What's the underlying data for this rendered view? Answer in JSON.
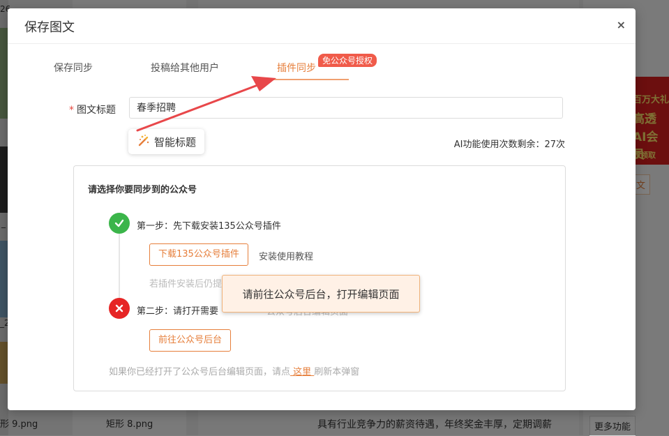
{
  "background": {
    "left_partial_1": "26",
    "left_partial_2": "_",
    "left_partial_3": "_2",
    "file_1": "形 9.png",
    "file_2": "矩形 8.png",
    "right_banner_lines": [
      "百万大礼",
      "高透",
      "AI会员",
      "即领取"
    ],
    "right_link": "文",
    "bottom_text": "具有行业竞争力的薪资待遇，年终奖金丰厚，定期调薪",
    "more_button": "更多功能"
  },
  "modal": {
    "title": "保存图文",
    "close": "×",
    "tabs": [
      {
        "label": "保存同步"
      },
      {
        "label": "投稿给其他用户"
      },
      {
        "label": "插件同步"
      }
    ],
    "tab_badge": "免公众号授权",
    "title_field": {
      "required_mark": "*",
      "label": "图文标题",
      "value": "春季招聘"
    },
    "smart_title_button": "智能标题",
    "ai_remaining": "AI功能使用次数剩余：27次",
    "sync_panel": {
      "heading": "请选择你要同步到的公众号",
      "step1_text": "第一步：先下载安装135公众号插件",
      "download_button": "下载135公众号插件",
      "tutorial_link": "安装使用教程",
      "step1_hint_partial": "若插件安装后仍提",
      "step2_text_partial": "第二步：请打开需要",
      "step2_hidden_partial": "公众号后台编辑页面",
      "goto_button": "前往公众号后台",
      "footer_prefix": "如果你已经打开了公众号后台编辑页面，请点",
      "footer_link": " 这里 ",
      "footer_suffix": "刷新本弹窗"
    },
    "tooltip": "请前往公众号后台，打开编辑页面"
  },
  "colors": {
    "accent": "#e67e3a",
    "badge": "#f05b4a",
    "success": "#3bb54a",
    "error": "#e62525",
    "arrow": "#e8474a"
  },
  "icons": {
    "step1": "check-icon",
    "step2": "cross-icon",
    "smart_title": "magic-wand-icon"
  }
}
